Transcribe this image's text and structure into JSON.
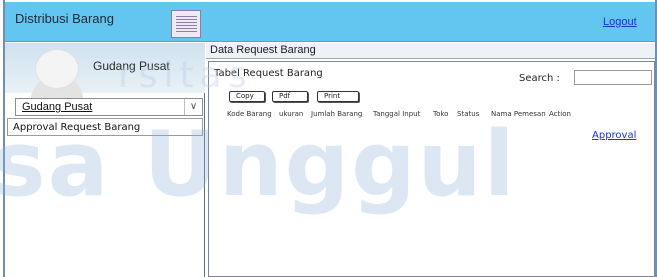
{
  "header": {
    "title": "Distribusi Barang",
    "logout_label": "Logout",
    "menu_icon": "hamburger-icon",
    "background": "#62c6f0"
  },
  "sidebar": {
    "profile_name": "Gudang Pusat",
    "avatar_icon": "user-avatar-icon",
    "role_select": {
      "value": "Gudang Pusat"
    },
    "menu_items": [
      {
        "label": "Approval Request Barang"
      }
    ]
  },
  "content": {
    "section_title": "Data Request Barang",
    "table_title": "Tabel Request Barang",
    "search": {
      "label": "Search :",
      "placeholder": ""
    },
    "buttons": {
      "copy": "Copy",
      "pdf": "Pdf",
      "print": "Print"
    },
    "columns": [
      "Kode Barang",
      "ukuran",
      "Jumlah Barang",
      "Tanggal Input",
      "Toko",
      "Status",
      "Nama Pemesan",
      "Action"
    ],
    "rows": [
      {
        "action": "Approval"
      }
    ]
  },
  "watermark": {
    "line1": "rsitas",
    "line2": "sa Unggul"
  },
  "colors": {
    "link": "#1a34d6",
    "accent": "#62c6f0"
  }
}
